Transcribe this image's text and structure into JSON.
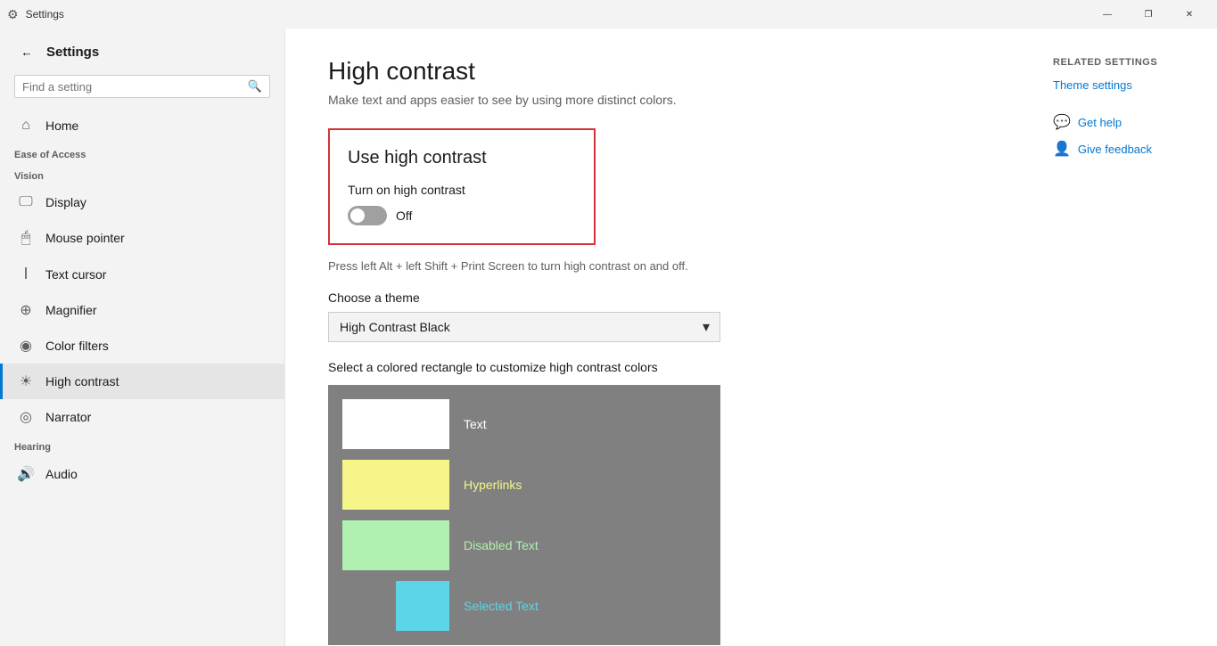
{
  "titlebar": {
    "title": "Settings",
    "min": "—",
    "max": "❐",
    "close": "✕"
  },
  "sidebar": {
    "app_title": "Settings",
    "search_placeholder": "Find a setting",
    "section_vision": "Vision",
    "section_hearing": "Hearing",
    "ease_of_access": "Ease of Access",
    "nav_items_top": [
      {
        "id": "home",
        "label": "Home",
        "icon": "⌂"
      }
    ],
    "nav_items_vision": [
      {
        "id": "display",
        "label": "Display",
        "icon": "🖥"
      },
      {
        "id": "mouse-pointer",
        "label": "Mouse pointer",
        "icon": "🖱"
      },
      {
        "id": "text-cursor",
        "label": "Text cursor",
        "icon": "I"
      },
      {
        "id": "magnifier",
        "label": "Magnifier",
        "icon": "🔍"
      },
      {
        "id": "color-filters",
        "label": "Color filters",
        "icon": "⊙"
      },
      {
        "id": "high-contrast",
        "label": "High contrast",
        "icon": "☀"
      }
    ],
    "nav_items_hearing": [
      {
        "id": "narrator",
        "label": "Narrator",
        "icon": "◎"
      },
      {
        "id": "audio",
        "label": "Audio",
        "icon": "🔊"
      }
    ]
  },
  "main": {
    "page_title": "High contrast",
    "page_subtitle": "Make text and apps easier to see by using more distinct colors.",
    "hc_box_title": "Use high contrast",
    "toggle_label": "Turn on high contrast",
    "toggle_state": "Off",
    "shortcut_hint": "Press left Alt + left Shift + Print Screen to turn high contrast on and off.",
    "theme_label": "Choose a theme",
    "theme_value": "High Contrast Black",
    "color_section_label": "Select a colored rectangle to customize high contrast colors",
    "colors": [
      {
        "name": "Text",
        "bg": "#ffffff",
        "text_color": "#ffffff"
      },
      {
        "name": "Hyperlinks",
        "bg": "#f5f58a",
        "text_color": "#f5f58a"
      },
      {
        "name": "Disabled Text",
        "bg": "#b0f0b0",
        "text_color": "#b0f0b0"
      },
      {
        "name": "Selected Text",
        "bg": "#5cd5e8",
        "text_color": "#5cd5e8"
      }
    ]
  },
  "right_panel": {
    "related_title": "Related settings",
    "links": [
      {
        "label": "Theme settings"
      }
    ],
    "help_items": [
      {
        "label": "Get help",
        "icon": "💬"
      },
      {
        "label": "Give feedback",
        "icon": "👤"
      }
    ]
  }
}
